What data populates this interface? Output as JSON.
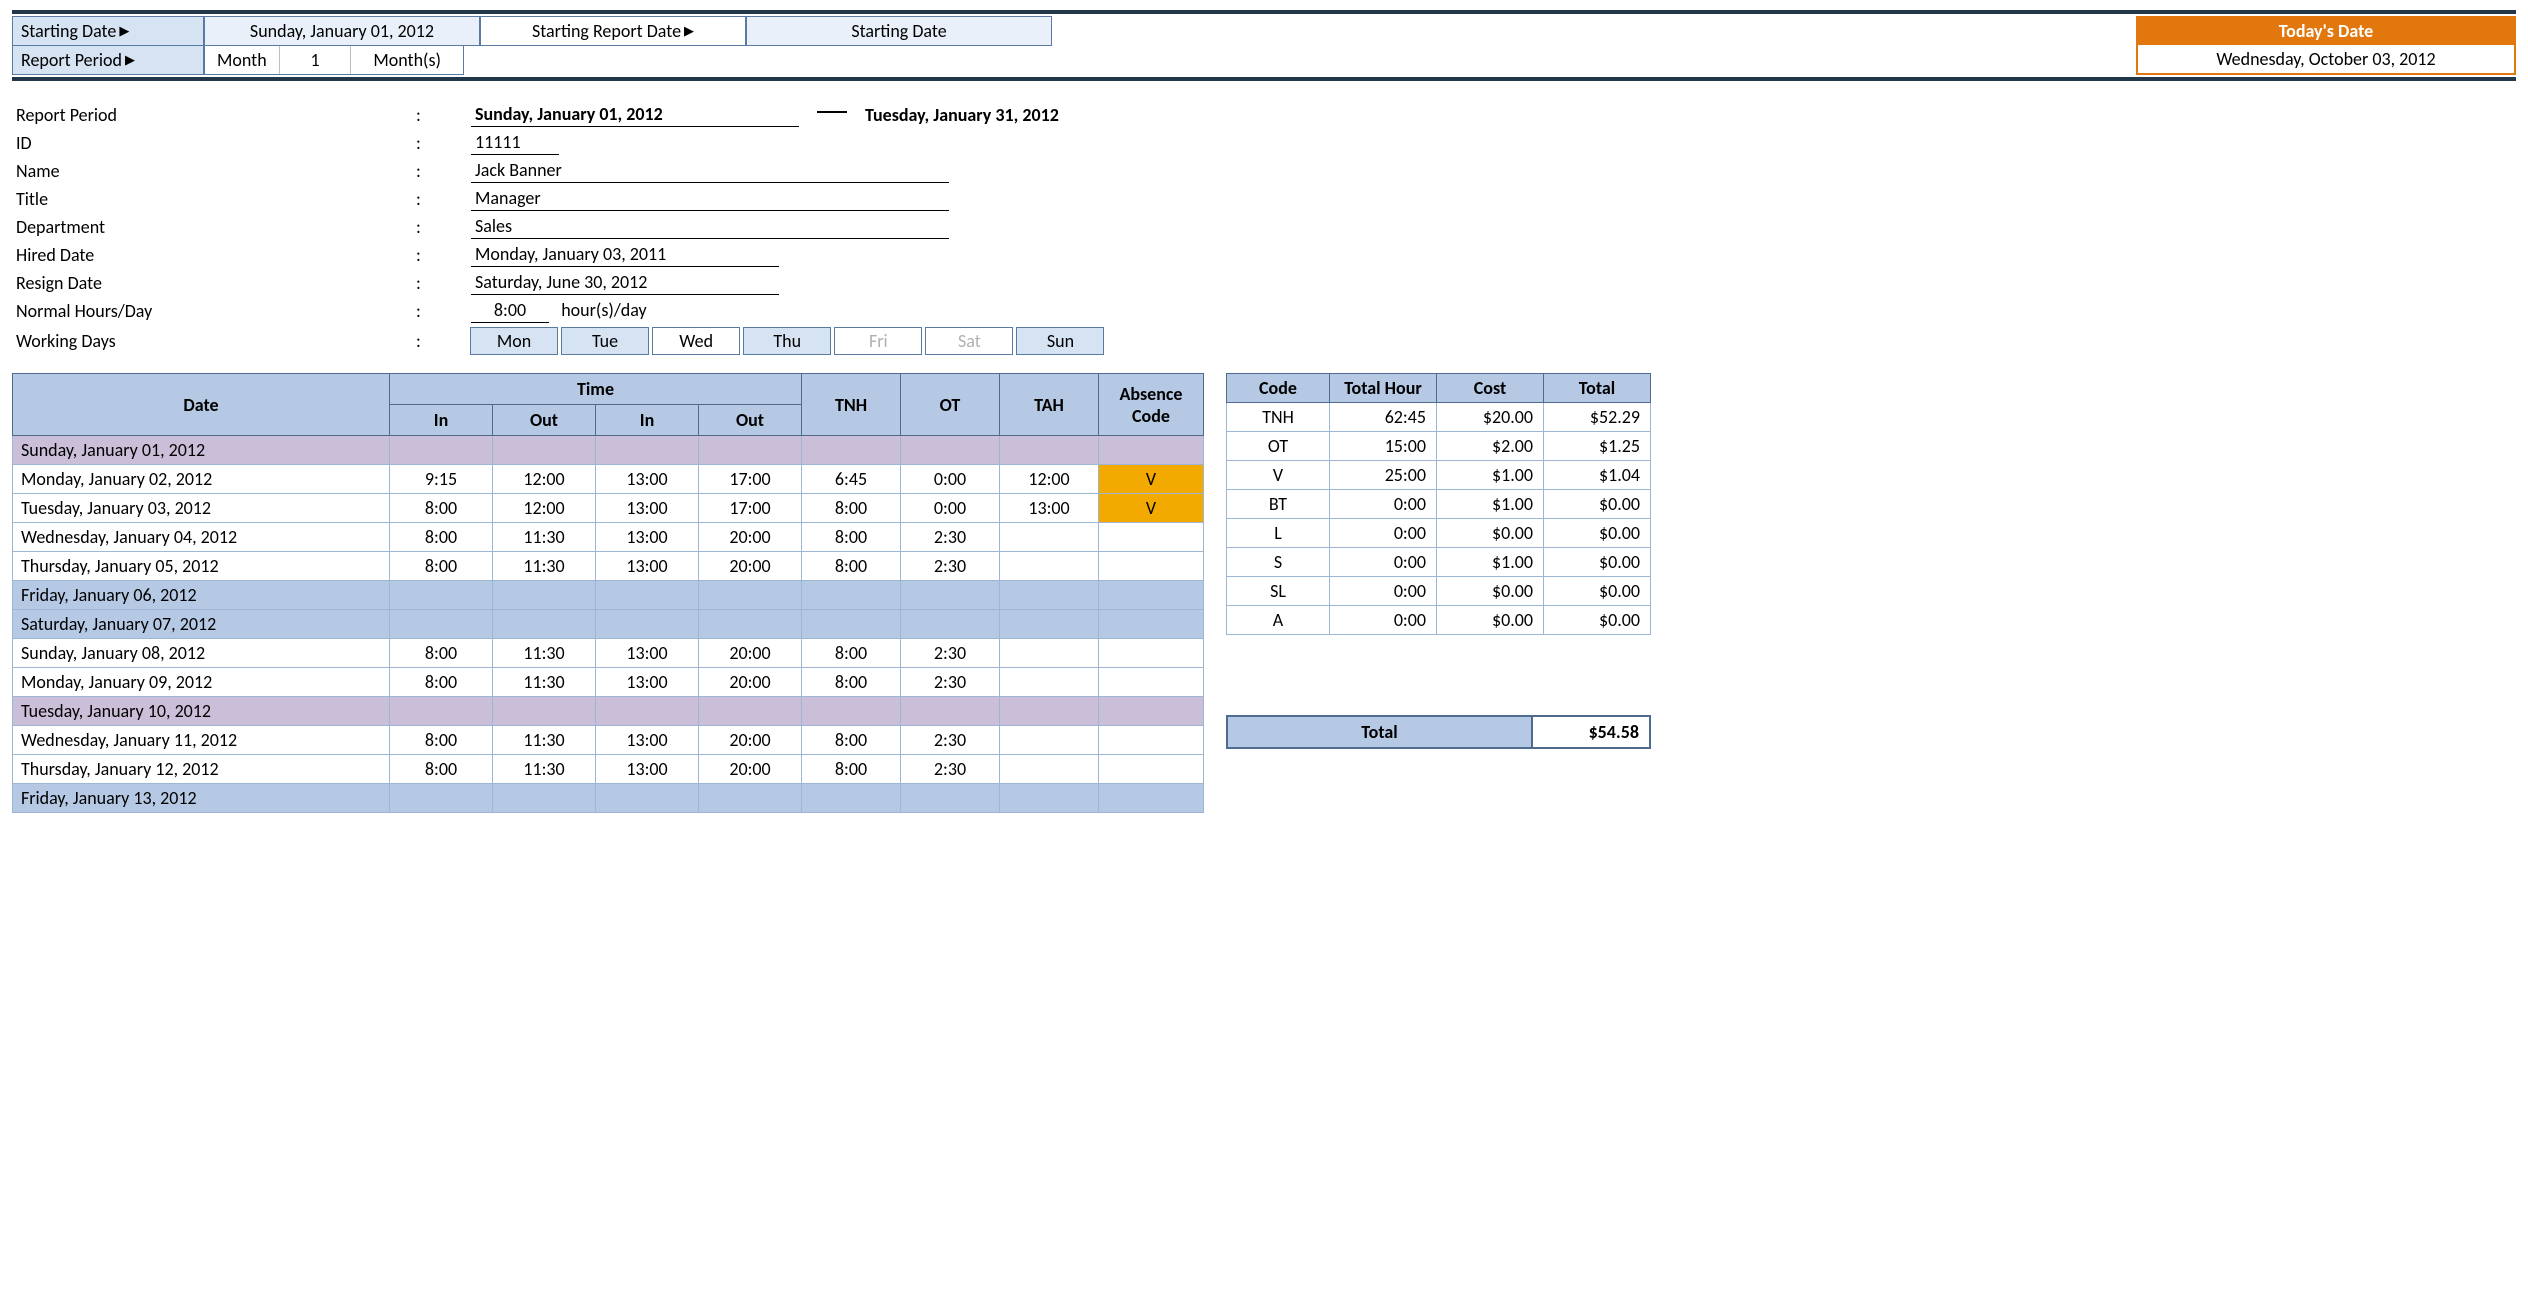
{
  "top": {
    "start_date_label": "Starting Date",
    "start_date_value": "Sunday, January 01, 2012",
    "report_period_label": "Report Period",
    "report_unit": "Month",
    "report_count": "1",
    "report_units": "Month(s)",
    "start_report_date_label": "Starting Report Date",
    "start_report_value": "Starting Date",
    "today_label": "Today's Date",
    "today_value": "Wednesday, October 03, 2012"
  },
  "info": {
    "report_period_label": "Report Period",
    "period_from": "Sunday, January 01, 2012",
    "period_to": "Tuesday, January 31, 2012",
    "id_label": "ID",
    "id": "11111",
    "name_label": "Name",
    "name": "Jack Banner",
    "title_label": "Title",
    "title": "Manager",
    "dept_label": "Department",
    "dept": "Sales",
    "hired_label": "Hired Date",
    "hired": "Monday, January 03, 2011",
    "resign_label": "Resign Date",
    "resign": "Saturday, June 30, 2012",
    "normal_label": "Normal Hours/Day",
    "normal_hours": "8:00",
    "normal_unit": "hour(s)/day",
    "working_days_label": "Working Days",
    "days": {
      "mon": "Mon",
      "tue": "Tue",
      "wed": "Wed",
      "thu": "Thu",
      "fri": "Fri",
      "sat": "Sat",
      "sun": "Sun"
    }
  },
  "headers": {
    "date": "Date",
    "time": "Time",
    "in": "In",
    "out": "Out",
    "tnh": "TNH",
    "ot": "OT",
    "tah": "TAH",
    "abs": "Absence Code",
    "code": "Code",
    "th": "Total Hour",
    "cost": "Cost",
    "total": "Total"
  },
  "rows": [
    {
      "date": "Sunday, January 01, 2012",
      "cls": "row-purple"
    },
    {
      "date": "Monday, January 02, 2012",
      "in1": "9:15",
      "out1": "12:00",
      "in2": "13:00",
      "out2": "17:00",
      "tnh": "6:45",
      "ot": "0:00",
      "tah": "12:00",
      "abs": "V",
      "absc": "abs-orange"
    },
    {
      "date": "Tuesday, January 03, 2012",
      "in1": "8:00",
      "out1": "12:00",
      "in2": "13:00",
      "out2": "17:00",
      "tnh": "8:00",
      "ot": "0:00",
      "tah": "13:00",
      "abs": "V",
      "absc": "abs-orange"
    },
    {
      "date": "Wednesday, January 04, 2012",
      "in1": "8:00",
      "out1": "11:30",
      "in2": "13:00",
      "out2": "20:00",
      "tnh": "8:00",
      "ot": "2:30"
    },
    {
      "date": "Thursday, January 05, 2012",
      "in1": "8:00",
      "out1": "11:30",
      "in2": "13:00",
      "out2": "20:00",
      "tnh": "8:00",
      "ot": "2:30"
    },
    {
      "date": "Friday, January 06, 2012",
      "cls": "row-blue"
    },
    {
      "date": "Saturday, January 07, 2012",
      "cls": "row-blue"
    },
    {
      "date": "Sunday, January 08, 2012",
      "in1": "8:00",
      "out1": "11:30",
      "in2": "13:00",
      "out2": "20:00",
      "tnh": "8:00",
      "ot": "2:30"
    },
    {
      "date": "Monday, January 09, 2012",
      "in1": "8:00",
      "out1": "11:30",
      "in2": "13:00",
      "out2": "20:00",
      "tnh": "8:00",
      "ot": "2:30"
    },
    {
      "date": "Tuesday, January 10, 2012",
      "cls": "row-purple"
    },
    {
      "date": "Wednesday, January 11, 2012",
      "in1": "8:00",
      "out1": "11:30",
      "in2": "13:00",
      "out2": "20:00",
      "tnh": "8:00",
      "ot": "2:30"
    },
    {
      "date": "Thursday, January 12, 2012",
      "in1": "8:00",
      "out1": "11:30",
      "in2": "13:00",
      "out2": "20:00",
      "tnh": "8:00",
      "ot": "2:30"
    },
    {
      "date": "Friday, January 13, 2012",
      "cls": "row-blue"
    }
  ],
  "summary": {
    "rows": [
      {
        "code": "TNH",
        "th": "62:45",
        "cost": "$20.00",
        "total": "$52.29"
      },
      {
        "code": "OT",
        "th": "15:00",
        "cost": "$2.00",
        "total": "$1.25"
      },
      {
        "code": "V",
        "th": "25:00",
        "cost": "$1.00",
        "total": "$1.04"
      },
      {
        "code": "BT",
        "th": "0:00",
        "cost": "$1.00",
        "total": "$0.00"
      },
      {
        "code": "L",
        "th": "0:00",
        "cost": "$0.00",
        "total": "$0.00"
      },
      {
        "code": "S",
        "th": "0:00",
        "cost": "$1.00",
        "total": "$0.00"
      },
      {
        "code": "SL",
        "th": "0:00",
        "cost": "$0.00",
        "total": "$0.00"
      },
      {
        "code": "A",
        "th": "0:00",
        "cost": "$0.00",
        "total": "$0.00"
      }
    ],
    "grand_label": "Total",
    "grand_total": "$54.58"
  }
}
